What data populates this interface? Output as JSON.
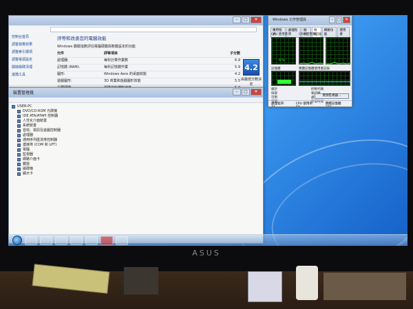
{
  "perf": {
    "title": "",
    "breadcrumb": "",
    "side_items": [
      "控制台首頁",
      "調整視覺效果",
      "調整索引選項",
      "調整電源設定",
      "開啟磁碟清理",
      "進階工具"
    ],
    "heading": "評等和改善您的電腦效能",
    "subtitle": "Windows 體驗指數評估電腦硬體與軟體設定的功能",
    "col_component": "元件",
    "col_rating": "評等項目",
    "col_subscore": "子分數",
    "col_base": "基本分數",
    "rows": [
      {
        "name": "處理器:",
        "desc": "每秒計算作業數",
        "score": "6.9"
      },
      {
        "name": "記憶體 (RAM):",
        "desc": "每秒記憶體作業",
        "score": "5.9"
      },
      {
        "name": "圖形:",
        "desc": "Windows Aero 的桌面效能",
        "score": "4.2"
      },
      {
        "name": "遊戲圖形:",
        "desc": "3D 商業和遊戲圖形效能",
        "score": "5.5"
      },
      {
        "name": "主要硬碟:",
        "desc": "磁碟資料傳輸速率",
        "score": "5.9"
      }
    ],
    "base_score": "4.2",
    "base_caption": "由最低分數決定"
  },
  "devmgr": {
    "title": "裝置管理員",
    "root": "USER-PC",
    "nodes": [
      "DVD/CD-ROM 光碟機",
      "IDE ATA/ATAPI 控制器",
      "人性化介面裝置",
      "系統裝置",
      "音效、視訊及遊戲控制器",
      "處理器",
      "通用序列匯流排控制器",
      "連接埠 (COM 和 LPT)",
      "電腦",
      "監視器",
      "網路介面卡",
      "鍵盤",
      "磁碟機",
      "顯示卡"
    ]
  },
  "taskmgr": {
    "title": "Windows 工作管理員",
    "tabs": [
      "應用程式",
      "處理程序",
      "服務",
      "效能",
      "網路功能",
      "使用者"
    ],
    "cpu_label": "CPU 使用率",
    "cpu_hist_label": "CPU 使用率記錄",
    "cpu_value": "0 %",
    "mem_label": "記憶體",
    "mem_hist_label": "實體記憶體使用量記錄",
    "mem_value": "",
    "stats_left": [
      [
        "總計",
        ""
      ],
      [
        "快取",
        ""
      ],
      [
        "可用",
        ""
      ],
      [
        "空閒",
        ""
      ]
    ],
    "stats_right": [
      [
        "控制代碼",
        ""
      ],
      [
        "執行緒",
        ""
      ],
      [
        "處理程序",
        ""
      ],
      [
        "存留時間",
        ""
      ]
    ],
    "resmon_btn": "資源監視器...",
    "status": [
      "處理程序: 44",
      "CPU 使用率: 0%",
      "實體記憶體: 29%"
    ]
  },
  "taskbar": {
    "clock_time": "",
    "clock_date": ""
  },
  "monitor": {
    "brand": "ASUS"
  }
}
